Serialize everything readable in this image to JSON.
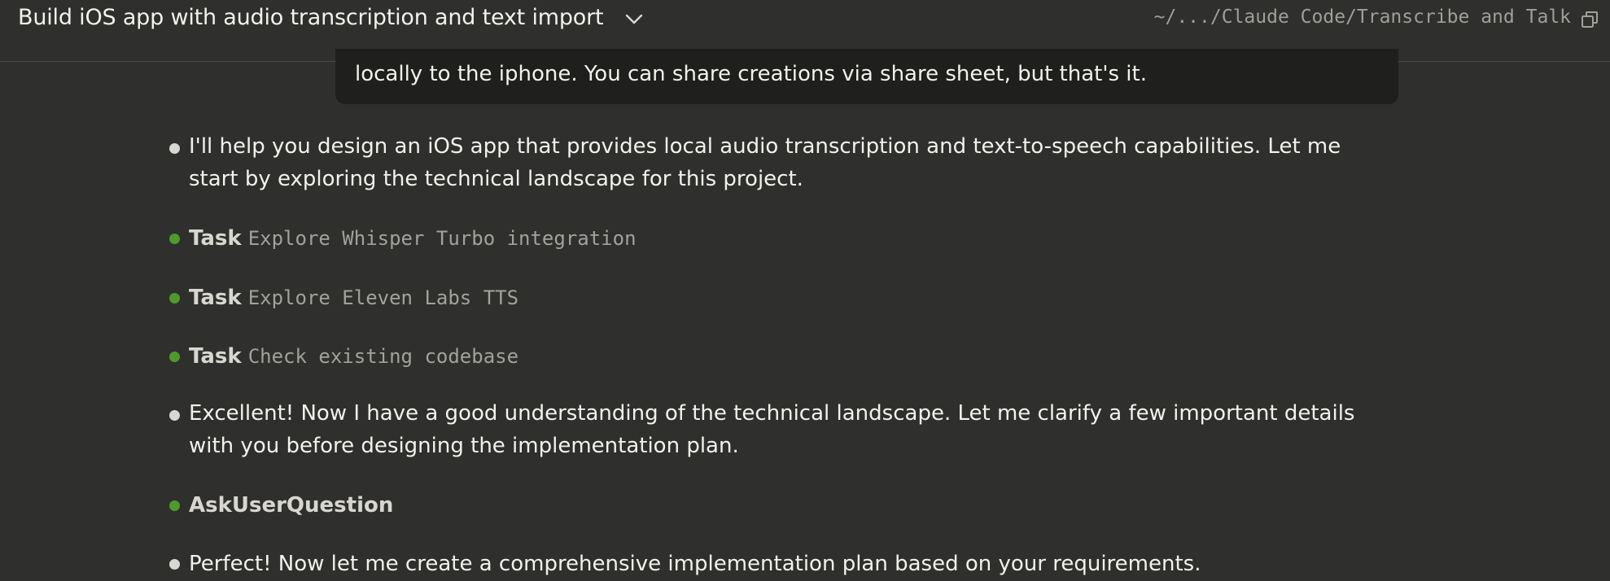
{
  "header": {
    "title": "Build iOS app with audio transcription and text import",
    "path": "~/.../Claude Code/Transcribe and Talk"
  },
  "user_message": {
    "text": "locally to the iphone. You can share creations via share sheet, but that's it."
  },
  "messages": [
    {
      "kind": "text",
      "text": "I'll help you design an iOS app that provides local audio transcription and text-to-speech capabilities. Let me start by exploring the technical landscape for this project."
    },
    {
      "kind": "task",
      "label": "Task",
      "desc": "Explore Whisper Turbo integration"
    },
    {
      "kind": "task",
      "label": "Task",
      "desc": "Explore Eleven Labs TTS"
    },
    {
      "kind": "task",
      "label": "Task",
      "desc": "Check existing codebase"
    },
    {
      "kind": "text",
      "text": "Excellent! Now I have a good understanding of the technical landscape. Let me clarify a few important details with you before designing the implementation plan."
    },
    {
      "kind": "tool",
      "label": "AskUserQuestion"
    },
    {
      "kind": "text",
      "text": "Perfect! Now let me create a comprehensive implementation plan based on your requirements."
    }
  ],
  "colors": {
    "background": "#2f2f2d",
    "bubble": "#1f1f1d",
    "bullet_text": "#d8d7d2",
    "bullet_tool": "#4e9a2c"
  },
  "icons": [
    "chevron-down-icon",
    "open-window-icon"
  ]
}
